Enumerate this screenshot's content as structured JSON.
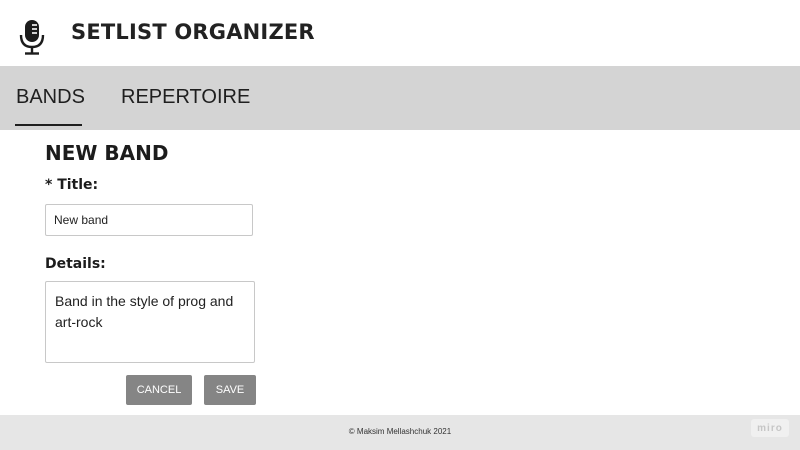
{
  "header": {
    "title": "SETLIST ORGANIZER",
    "logo_icon": "microphone-icon"
  },
  "tabs": [
    {
      "label": "BANDS",
      "active": true
    },
    {
      "label": "REPERTOIRE",
      "active": false
    }
  ],
  "form": {
    "heading": "NEW BAND",
    "title_label": "* Title:",
    "title_value": "New band",
    "details_label": "Details:",
    "details_value": "Band in the style of prog and\nart-rock",
    "cancel_label": "CANCEL",
    "save_label": "SAVE"
  },
  "footer": {
    "copyright": "© Maksim Mellashchuk 2021",
    "badge": "miro"
  },
  "colors": {
    "tab_bar": "#d4d4d4",
    "button": "#858585",
    "footer": "#e6e6e6"
  }
}
